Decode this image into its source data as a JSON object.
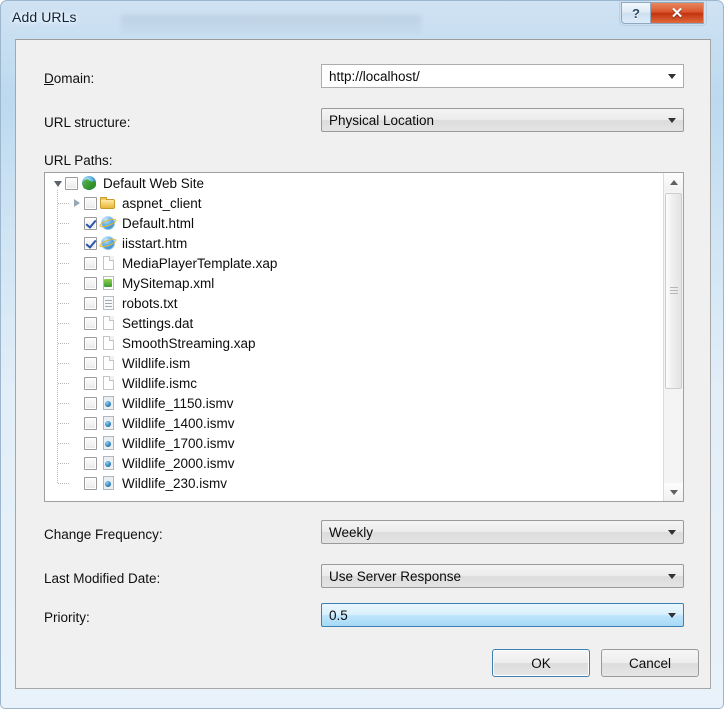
{
  "window": {
    "title": "Add URLs",
    "help_button": "?",
    "close_button": "✕"
  },
  "fields": {
    "domain_label_prefix": "",
    "domain_label_accel": "D",
    "domain_label_rest": "omain:",
    "domain_label": "Domain:",
    "domain_value": "http://localhost/",
    "url_structure_label": "URL structure:",
    "url_structure_value": "Physical Location",
    "url_paths_label": "URL Paths:",
    "change_frequency_label": "Change Frequency:",
    "change_frequency_value": "Weekly",
    "last_modified_label": "Last Modified Date:",
    "last_modified_value": "Use Server Response",
    "priority_label": "Priority:",
    "priority_value": "0.5"
  },
  "tree": {
    "items": [
      {
        "label": "Default Web Site",
        "depth": 0,
        "checked": false,
        "icon": "globe",
        "twisty": "open"
      },
      {
        "label": "aspnet_client",
        "depth": 1,
        "checked": false,
        "icon": "folder",
        "twisty": "closed"
      },
      {
        "label": "Default.html",
        "depth": 1,
        "checked": true,
        "icon": "html",
        "twisty": "none"
      },
      {
        "label": "iisstart.htm",
        "depth": 1,
        "checked": true,
        "icon": "html",
        "twisty": "none"
      },
      {
        "label": "MediaPlayerTemplate.xap",
        "depth": 1,
        "checked": false,
        "icon": "doc",
        "twisty": "none"
      },
      {
        "label": "MySitemap.xml",
        "depth": 1,
        "checked": false,
        "icon": "xml",
        "twisty": "none"
      },
      {
        "label": "robots.txt",
        "depth": 1,
        "checked": false,
        "icon": "txt",
        "twisty": "none"
      },
      {
        "label": "Settings.dat",
        "depth": 1,
        "checked": false,
        "icon": "doc",
        "twisty": "none"
      },
      {
        "label": "SmoothStreaming.xap",
        "depth": 1,
        "checked": false,
        "icon": "doc",
        "twisty": "none"
      },
      {
        "label": "Wildlife.ism",
        "depth": 1,
        "checked": false,
        "icon": "doc",
        "twisty": "none"
      },
      {
        "label": "Wildlife.ismc",
        "depth": 1,
        "checked": false,
        "icon": "doc",
        "twisty": "none"
      },
      {
        "label": "Wildlife_1150.ismv",
        "depth": 1,
        "checked": false,
        "icon": "media",
        "twisty": "none"
      },
      {
        "label": "Wildlife_1400.ismv",
        "depth": 1,
        "checked": false,
        "icon": "media",
        "twisty": "none"
      },
      {
        "label": "Wildlife_1700.ismv",
        "depth": 1,
        "checked": false,
        "icon": "media",
        "twisty": "none"
      },
      {
        "label": "Wildlife_2000.ismv",
        "depth": 1,
        "checked": false,
        "icon": "media",
        "twisty": "none"
      },
      {
        "label": "Wildlife_230.ismv",
        "depth": 1,
        "checked": false,
        "icon": "media",
        "twisty": "none"
      }
    ]
  },
  "buttons": {
    "ok": "OK",
    "cancel": "Cancel"
  },
  "colors": {
    "accent_focus": "#3c7fb1",
    "close_red": "#c2330f",
    "dialog_bg": "#f0f0f0",
    "glass": "#cfe2f3"
  }
}
